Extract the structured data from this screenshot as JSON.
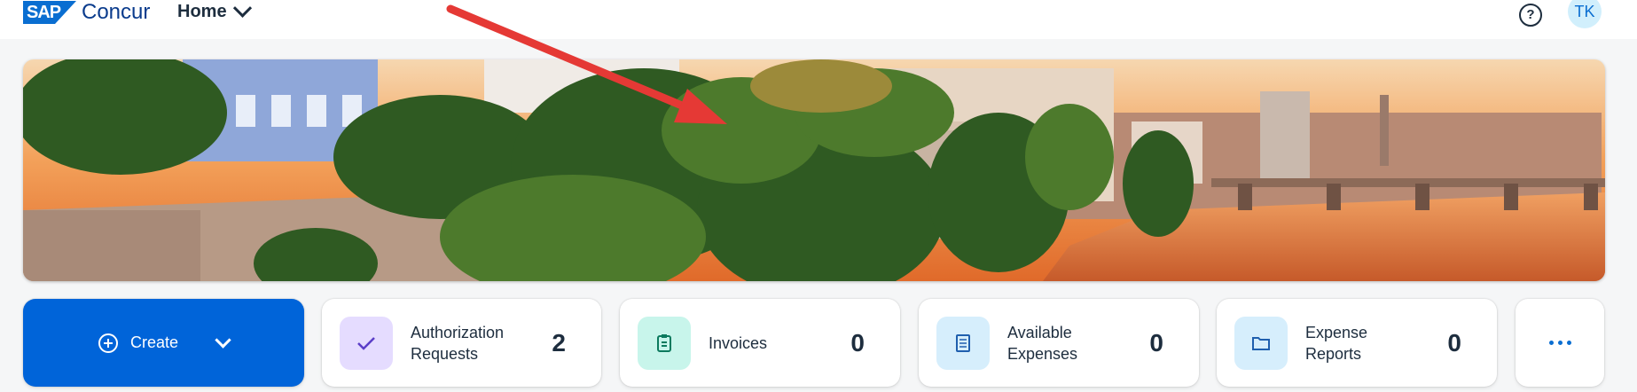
{
  "header": {
    "brand_sap": "SAP",
    "brand_concur": "Concur",
    "home_label": "Home",
    "help_icon": "help-icon",
    "avatar_initials": "TK"
  },
  "colors": {
    "brand_blue": "#0a6ed1",
    "create_blue": "#0064d9",
    "arrow_red": "#e53935"
  },
  "tiles": {
    "create": {
      "label": "Create"
    },
    "authorization": {
      "label_line1": "Authorization",
      "label_line2": "Requests",
      "count": "2",
      "icon": "checkmark-icon",
      "icon_bg": "#e5dcff"
    },
    "invoices": {
      "label_line1": "Invoices",
      "label_line2": "",
      "count": "0",
      "icon": "clipboard-icon",
      "icon_bg": "#c8f5eb"
    },
    "available_expenses": {
      "label_line1": "Available",
      "label_line2": "Expenses",
      "count": "0",
      "icon": "receipt-icon",
      "icon_bg": "#d6eefc"
    },
    "expense_reports": {
      "label_line1": "Expense",
      "label_line2": "Reports",
      "count": "0",
      "icon": "folder-icon",
      "icon_bg": "#d6eefc"
    },
    "more": {
      "icon": "more-dots-icon"
    }
  }
}
